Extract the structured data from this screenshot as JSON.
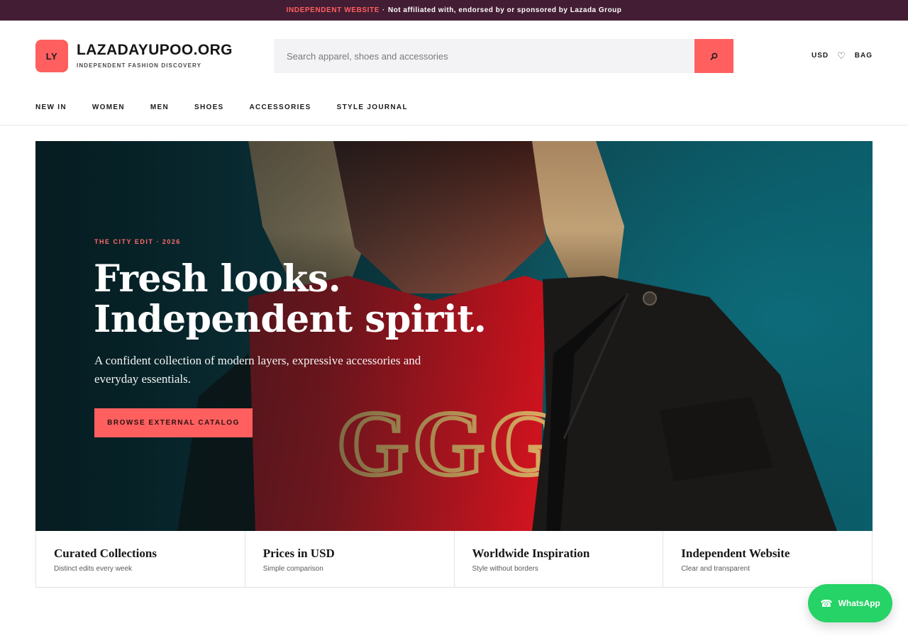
{
  "topbar": {
    "highlight": "INDEPENDENT WEBSITE",
    "separator": "·",
    "notice": "Not affiliated with, endorsed by or sponsored by Lazada Group",
    "accent_color": "#ff5f5f",
    "background_color": "#431d33"
  },
  "brand": {
    "mark": "LY",
    "name": "LAZADAYUPOO.ORG",
    "tagline": "INDEPENDENT FASHION DISCOVERY"
  },
  "search": {
    "placeholder": "Search apparel, shoes and accessories",
    "value": "",
    "button_icon": "search-icon"
  },
  "header_actions": {
    "currency": "USD",
    "wishlist_icon": "heart-icon",
    "bag": "BAG"
  },
  "nav": {
    "items": [
      {
        "label": "NEW IN"
      },
      {
        "label": "WOMEN"
      },
      {
        "label": "MEN"
      },
      {
        "label": "SHOES"
      },
      {
        "label": "ACCESSORIES"
      },
      {
        "label": "STYLE JOURNAL"
      }
    ]
  },
  "hero": {
    "eyebrow": "THE CITY EDIT · 2026",
    "title_line1": "Fresh looks.",
    "title_line2": "Independent spirit.",
    "subtitle": "A confident collection of modern layers, expressive accessories and everyday essentials.",
    "cta": "BROWSE EXTERNAL CATALOG",
    "shirt_print": "GGG"
  },
  "features": [
    {
      "title": "Curated Collections",
      "subtitle": "Distinct edits every week"
    },
    {
      "title": "Prices in USD",
      "subtitle": "Simple comparison"
    },
    {
      "title": "Worldwide Inspiration",
      "subtitle": "Style without borders"
    },
    {
      "title": "Independent Website",
      "subtitle": "Clear and transparent"
    }
  ],
  "whatsapp": {
    "label": "WhatsApp",
    "icon": "phone-icon",
    "color": "#25d366"
  }
}
